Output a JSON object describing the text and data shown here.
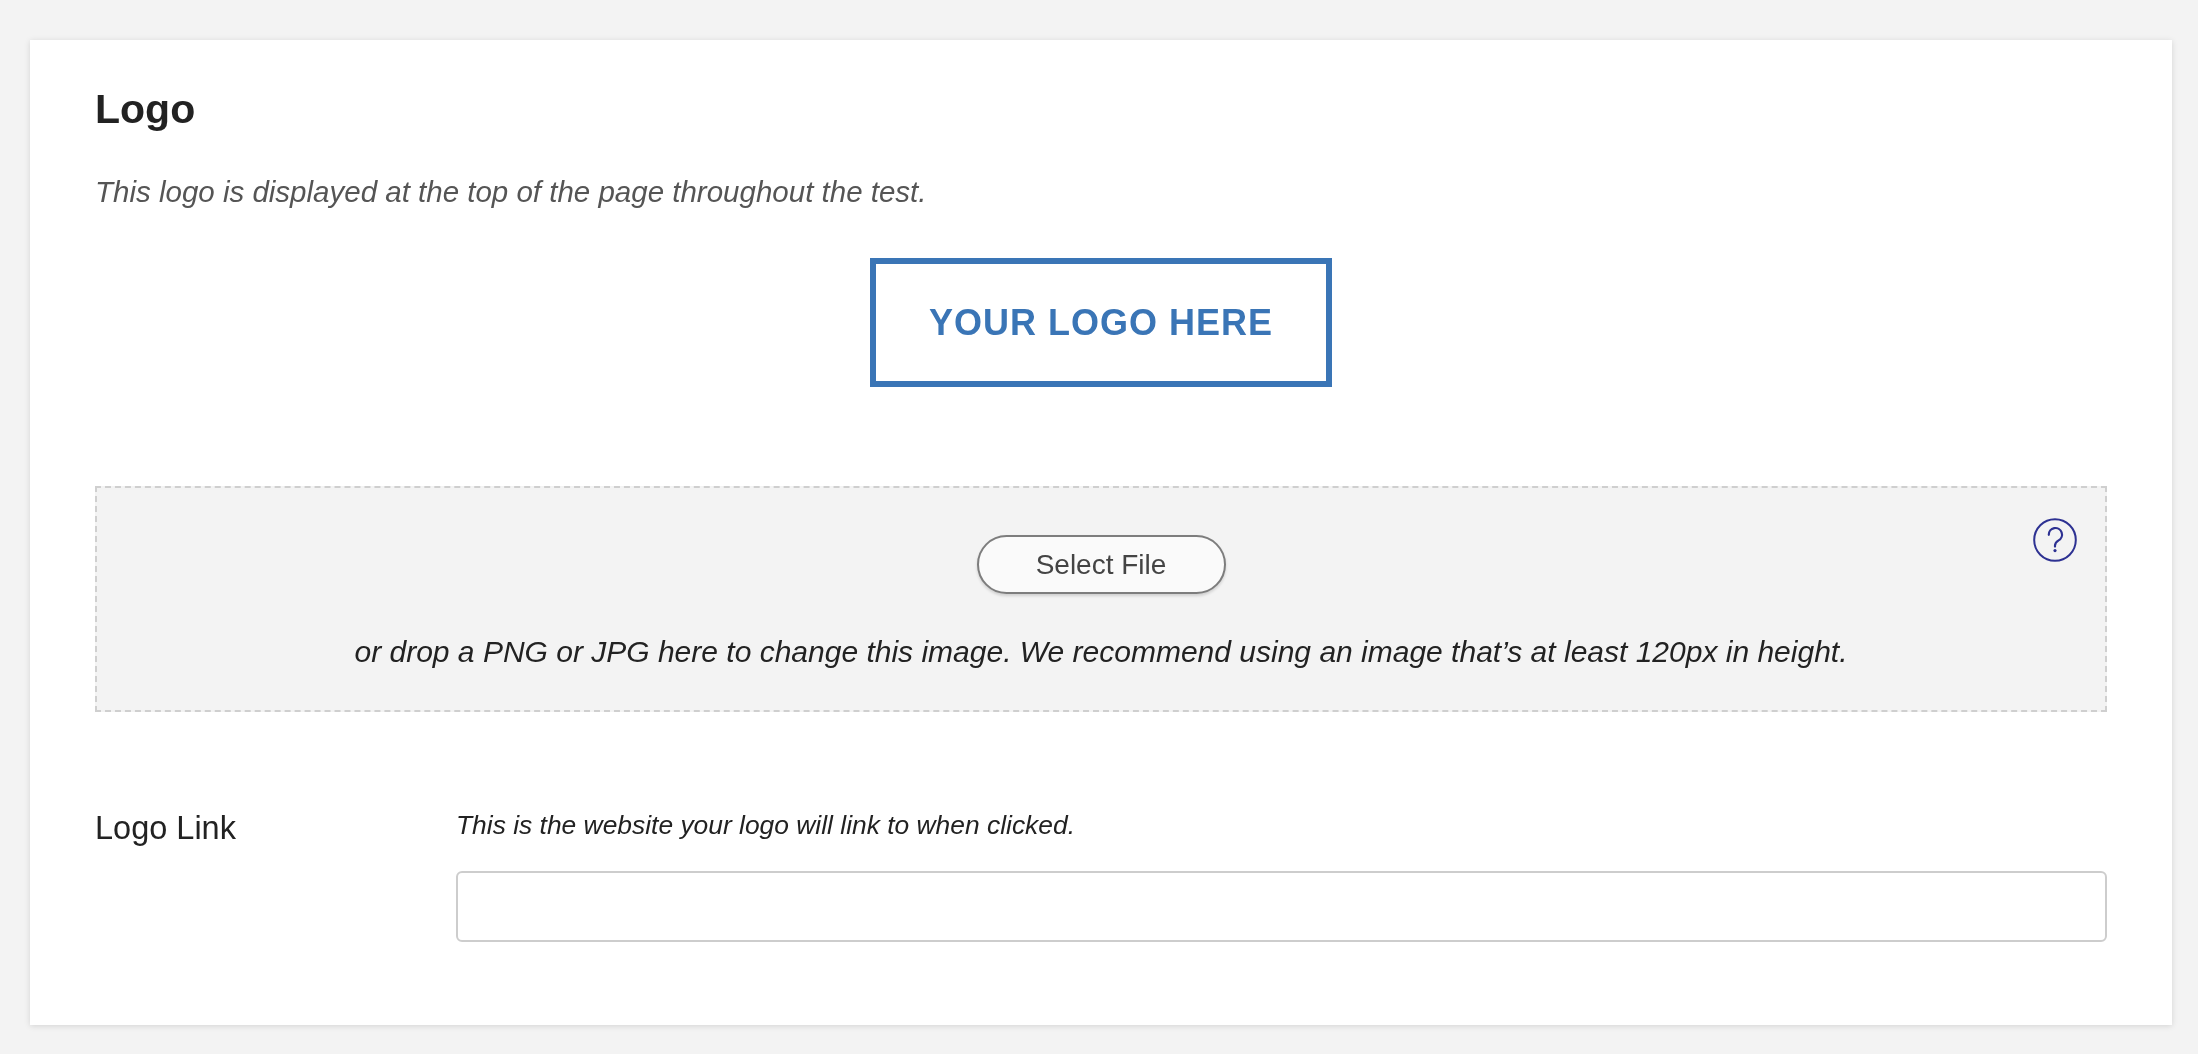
{
  "section": {
    "title": "Logo",
    "description": "This logo is displayed at the top of the page throughout the test."
  },
  "logo_preview": {
    "text": "YOUR LOGO HERE"
  },
  "upload": {
    "button": "Select File",
    "hint": "or drop a PNG or JPG here to change this image. We recommend using an image that’s at least 120px in height."
  },
  "logo_link": {
    "label": "Logo Link",
    "help": "This is the website your logo will link to when clicked."
  }
}
